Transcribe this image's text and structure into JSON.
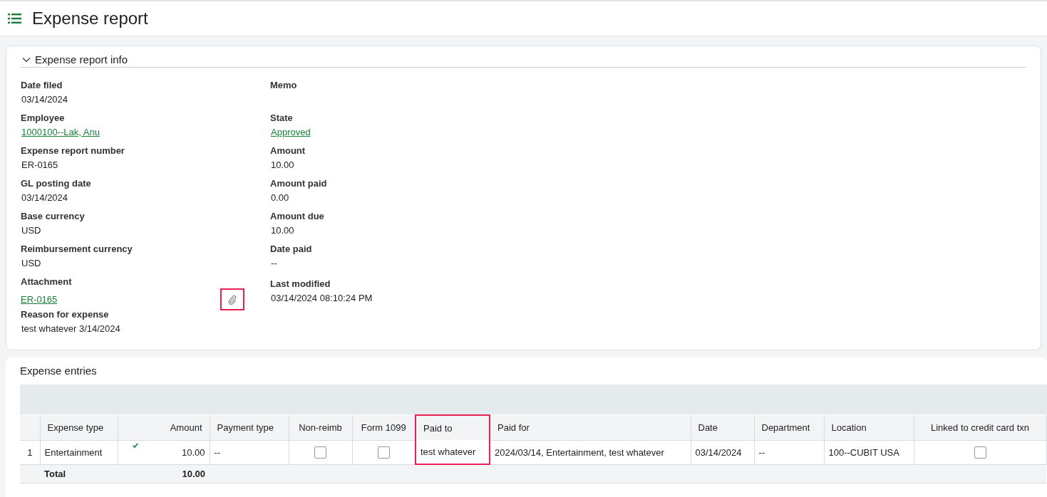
{
  "page": {
    "title": "Expense report"
  },
  "info": {
    "title": "Expense report info",
    "expanded": true,
    "left": [
      {
        "label": "Date filed",
        "value": "03/14/2024",
        "kind": "text"
      },
      {
        "label": "Employee",
        "value": "1000100--Lak, Anu",
        "kind": "link"
      },
      {
        "label": "Expense report number",
        "value": "ER-0165",
        "kind": "text"
      },
      {
        "label": "GL posting date",
        "value": "03/14/2024",
        "kind": "text"
      },
      {
        "label": "Base currency",
        "value": "USD",
        "kind": "text"
      },
      {
        "label": "Reimbursement currency",
        "value": "USD",
        "kind": "text"
      },
      {
        "label": "Attachment",
        "value": "ER-0165",
        "kind": "attachment",
        "highlighted": true
      },
      {
        "label": "Reason for expense",
        "value": "test whatever 3/14/2024",
        "kind": "text"
      }
    ],
    "right": [
      {
        "label": "Memo",
        "kind": "empty"
      },
      {
        "label": "State",
        "value": "Approved",
        "kind": "link"
      },
      {
        "label": "Amount",
        "value": "10.00",
        "kind": "text"
      },
      {
        "label": "Amount paid",
        "value": "0.00",
        "kind": "text"
      },
      {
        "label": "Amount due",
        "value": "10.00",
        "kind": "text"
      },
      {
        "label": "Date paid",
        "value": "--",
        "kind": "text"
      },
      {
        "label": "Last modified",
        "value": "03/14/2024 08:10:24 PM",
        "kind": "text"
      }
    ]
  },
  "entries": {
    "title": "Expense entries",
    "columns": [
      {
        "label": "Expense type",
        "highlighted": false
      },
      {
        "label": "Amount",
        "highlighted": false
      },
      {
        "label": "Payment type",
        "highlighted": false
      },
      {
        "label": "Non-reimb",
        "highlighted": false
      },
      {
        "label": "Form 1099",
        "highlighted": false
      },
      {
        "label": "Paid to",
        "highlighted": true
      },
      {
        "label": "Paid for",
        "highlighted": false
      },
      {
        "label": "Date",
        "highlighted": false
      },
      {
        "label": "Department",
        "highlighted": false
      },
      {
        "label": "Location",
        "highlighted": false
      },
      {
        "label": "Linked to credit card txn",
        "highlighted": false
      }
    ],
    "rows": [
      {
        "number": "1",
        "cells": [
          {
            "kind": "text",
            "value": "Entertainment"
          },
          {
            "kind": "amount",
            "value": "10.00",
            "validated": true
          },
          {
            "kind": "text",
            "value": "--"
          },
          {
            "kind": "checkbox",
            "checked": false
          },
          {
            "kind": "checkbox",
            "checked": false
          },
          {
            "kind": "text",
            "value": "test whatever"
          },
          {
            "kind": "text",
            "value": "2024/03/14, Entertainment, test whatever"
          },
          {
            "kind": "text",
            "value": "03/14/2024"
          },
          {
            "kind": "text",
            "value": "--"
          },
          {
            "kind": "text",
            "value": "100--CUBIT USA"
          },
          {
            "kind": "checkbox",
            "checked": false
          }
        ]
      }
    ],
    "total": {
      "label": "Total",
      "amount": "10.00"
    }
  }
}
